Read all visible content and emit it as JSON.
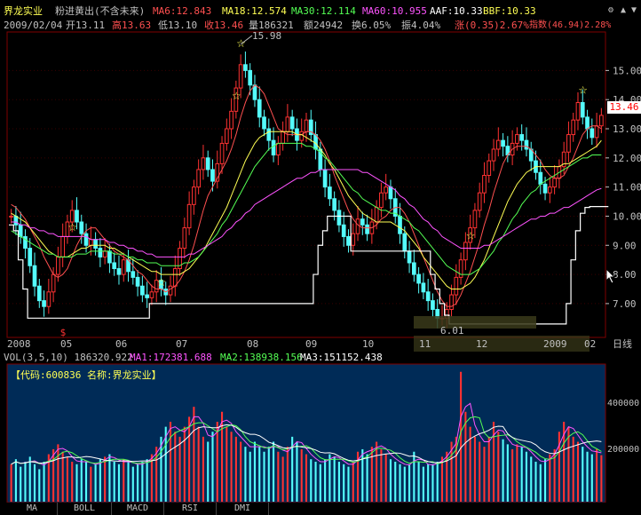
{
  "header": {
    "stock_name": "界龙实业",
    "signal": "粉进黄出(不含未来)",
    "ma6": "MA6:12.843",
    "ma18": "MA18:12.574",
    "ma30": "MA30:12.114",
    "ma60": "MA60:10.955",
    "aaf": "AAF:10.33",
    "bbf": "BBF:10.33"
  },
  "quote": {
    "date": "2009/02/04",
    "open": "开13.11",
    "high": "高13.63",
    "low": "低13.10",
    "close": "收13.46",
    "volume": "量186321",
    "amount": "额24942",
    "turnover": "换6.05%",
    "amplitude": "振4.04%",
    "change": "涨(0.35)2.67%",
    "index": "指数(46.94)2.28%"
  },
  "price_axis": {
    "ticks": [
      "15.00",
      "14.00",
      "13.00",
      "12.00",
      "11.00",
      "10.00",
      "9.00",
      "8.00",
      "7.00"
    ],
    "current_price": "13.46",
    "high_label": "15.98",
    "low_label": "6.01"
  },
  "time_axis": {
    "labels": [
      "2008",
      "05",
      "06",
      "07",
      "08",
      "09",
      "10",
      "11",
      "12",
      "2009",
      "02"
    ],
    "period": "日线"
  },
  "volume": {
    "header": "VOL(3,5,10) 186320.922",
    "ma1": "MA1:172381.688",
    "ma2": "MA2:138938.156",
    "ma3": "MA3:151152.438",
    "code_label": "【代码:600836 名称:界龙实业】",
    "ticks": [
      "400000",
      "200000"
    ]
  },
  "tabs": [
    "MA",
    "BOLL",
    "MACD",
    "RSI",
    "DMI"
  ],
  "colors": {
    "background": "#000000",
    "volume_background": "#002b57",
    "up": "#ff3232",
    "down": "#54fcfc",
    "ma6": "#ff5050",
    "ma18": "#ffff54",
    "ma30": "#54ff54",
    "ma60": "#ff54ff",
    "aaf": "#ffffff"
  },
  "chart_data": {
    "type": "candlestick",
    "price_range": [
      5.9,
      16.2
    ],
    "volume_range": [
      0,
      480000
    ],
    "closes": [
      10.0,
      9.7,
      9.3,
      8.9,
      8.3,
      7.6,
      7.1,
      6.9,
      7.4,
      8.0,
      8.6,
      9.3,
      9.8,
      10.2,
      9.8,
      9.4,
      9.0,
      9.2,
      8.9,
      8.6,
      8.8,
      8.4,
      8.2,
      8.0,
      8.5,
      8.1,
      7.9,
      7.6,
      7.3,
      7.2,
      7.4,
      7.8,
      7.5,
      7.3,
      7.6,
      8.2,
      8.9,
      9.6,
      10.4,
      11.0,
      11.6,
      12.0,
      11.6,
      11.2,
      11.8,
      12.5,
      13.0,
      13.6,
      14.4,
      15.2,
      15.0,
      14.5,
      14.0,
      13.4,
      13.0,
      12.6,
      12.1,
      12.5,
      12.9,
      13.4,
      13.0,
      12.6,
      12.9,
      13.3,
      12.8,
      12.3,
      11.6,
      11.0,
      10.6,
      10.2,
      9.7,
      9.3,
      9.0,
      9.4,
      9.9,
      9.7,
      9.4,
      9.8,
      10.3,
      10.8,
      11.0,
      10.6,
      10.0,
      9.4,
      8.8,
      8.4,
      8.0,
      7.7,
      7.4,
      7.1,
      6.8,
      6.5,
      6.5,
      6.8,
      7.3,
      7.9,
      8.5,
      9.1,
      9.6,
      10.2,
      10.8,
      11.4,
      11.9,
      12.3,
      12.6,
      12.4,
      12.1,
      12.5,
      12.8,
      12.6,
      12.3,
      11.9,
      11.5,
      11.1,
      10.8,
      11.0,
      11.3,
      11.7,
      12.2,
      12.8,
      13.3,
      13.9,
      13.4,
      13.0,
      12.7,
      13.1,
      13.46
    ],
    "volumes": [
      150000,
      170000,
      140000,
      160000,
      180000,
      150000,
      130000,
      160000,
      190000,
      210000,
      230000,
      200000,
      180000,
      160000,
      150000,
      170000,
      160000,
      140000,
      150000,
      170000,
      180000,
      190000,
      160000,
      150000,
      170000,
      160000,
      140000,
      150000,
      160000,
      170000,
      190000,
      220000,
      260000,
      300000,
      320000,
      280000,
      260000,
      300000,
      340000,
      380000,
      300000,
      260000,
      240000,
      280000,
      320000,
      360000,
      300000,
      280000,
      260000,
      240000,
      220000,
      200000,
      240000,
      220000,
      200000,
      220000,
      240000,
      200000,
      180000,
      220000,
      260000,
      240000,
      210000,
      190000,
      170000,
      160000,
      150000,
      170000,
      190000,
      180000,
      160000,
      150000,
      140000,
      160000,
      200000,
      210000,
      190000,
      220000,
      240000,
      210000,
      190000,
      170000,
      160000,
      150000,
      140000,
      150000,
      200000,
      160000,
      140000,
      150000,
      150000,
      160000,
      180000,
      200000,
      240000,
      260000,
      520000,
      360000,
      300000,
      260000,
      240000,
      220000,
      260000,
      320000,
      280000,
      250000,
      230000,
      210000,
      230000,
      220000,
      200000,
      180000,
      160000,
      150000,
      170000,
      190000,
      210000,
      280000,
      320000,
      300000,
      260000,
      240000,
      220000,
      200000,
      190000,
      210000,
      186321
    ],
    "ma6": [
      10.4,
      10.3,
      10.1,
      9.9,
      9.6,
      9.3,
      9.0,
      8.6,
      8.3,
      8.0,
      7.9,
      8.0,
      8.2,
      8.6,
      9.0,
      9.3,
      9.5,
      9.6,
      9.6,
      9.4,
      9.2,
      9.0,
      8.8,
      8.7,
      8.6,
      8.5,
      8.3,
      8.1,
      8.0,
      7.8,
      7.6,
      7.5,
      7.5,
      7.4,
      7.5,
      7.6,
      7.8,
      8.1,
      8.5,
      9.0,
      9.6,
      10.2,
      10.7,
      11.0,
      11.3,
      11.6,
      11.9,
      12.3,
      12.8,
      13.4,
      13.9,
      14.3,
      14.5,
      14.4,
      14.2,
      13.8,
      13.4,
      13.0,
      12.9,
      12.8,
      12.8,
      12.8,
      12.8,
      12.9,
      12.9,
      12.8,
      12.6,
      12.3,
      11.9,
      11.4,
      11.0,
      10.6,
      10.2,
      9.9,
      9.7,
      9.6,
      9.6,
      9.6,
      9.7,
      9.9,
      10.0,
      10.2,
      10.3,
      10.3,
      10.1,
      9.8,
      9.4,
      9.0,
      8.6,
      8.2,
      7.8,
      7.4,
      7.1,
      6.9,
      6.9,
      7.0,
      7.3,
      7.7,
      8.1,
      8.6,
      9.1,
      9.7,
      10.2,
      10.8,
      11.3,
      11.8,
      12.1,
      12.3,
      12.4,
      12.4,
      12.4,
      12.3,
      12.1,
      11.9,
      11.6,
      11.4,
      11.3,
      11.3,
      11.4,
      11.7,
      12.0,
      12.4,
      12.8,
      13.0,
      13.1,
      13.1,
      13.0
    ],
    "ma18": [
      10.1,
      10.0,
      9.9,
      9.8,
      9.6,
      9.4,
      9.2,
      9.0,
      8.8,
      8.7,
      8.6,
      8.6,
      8.6,
      8.7,
      8.8,
      8.9,
      8.9,
      9.0,
      9.0,
      9.0,
      9.0,
      8.9,
      8.9,
      8.8,
      8.7,
      8.6,
      8.5,
      8.4,
      8.3,
      8.2,
      8.1,
      8.1,
      8.0,
      8.0,
      8.0,
      8.0,
      8.0,
      8.1,
      8.2,
      8.4,
      8.6,
      8.8,
      9.1,
      9.4,
      9.7,
      10.0,
      10.3,
      10.7,
      11.1,
      11.5,
      11.9,
      12.2,
      12.5,
      12.7,
      12.8,
      12.9,
      12.9,
      12.9,
      12.9,
      12.9,
      12.9,
      12.8,
      12.8,
      12.7,
      12.6,
      12.5,
      12.3,
      12.1,
      11.8,
      11.6,
      11.3,
      11.0,
      10.7,
      10.5,
      10.3,
      10.1,
      10.0,
      9.9,
      9.8,
      9.8,
      9.8,
      9.8,
      9.7,
      9.6,
      9.5,
      9.3,
      9.1,
      8.9,
      8.6,
      8.4,
      8.2,
      8.0,
      7.8,
      7.6,
      7.5,
      7.5,
      7.5,
      7.6,
      7.7,
      7.9,
      8.2,
      8.5,
      8.9,
      9.3,
      9.7,
      10.1,
      10.5,
      10.8,
      11.1,
      11.3,
      11.5,
      11.6,
      11.7,
      11.7,
      11.7,
      11.7,
      11.7,
      11.7,
      11.8,
      11.8,
      11.9,
      12.0,
      12.1,
      12.2,
      12.3,
      12.4,
      12.6
    ],
    "ma30": [
      9.5,
      9.4,
      9.3,
      9.2,
      9.1,
      9.0,
      8.9,
      8.8,
      8.7,
      8.7,
      8.6,
      8.6,
      8.6,
      8.6,
      8.7,
      8.7,
      8.7,
      8.8,
      8.8,
      8.8,
      8.8,
      8.8,
      8.7,
      8.7,
      8.7,
      8.6,
      8.6,
      8.5,
      8.5,
      8.4,
      8.4,
      8.4,
      8.3,
      8.3,
      8.3,
      8.3,
      8.3,
      8.4,
      8.4,
      8.5,
      8.6,
      8.8,
      9.0,
      9.2,
      9.4,
      9.7,
      9.9,
      10.2,
      10.5,
      10.8,
      11.1,
      11.4,
      11.7,
      11.9,
      12.1,
      12.3,
      12.4,
      12.5,
      12.5,
      12.5,
      12.5,
      12.5,
      12.5,
      12.4,
      12.4,
      12.3,
      12.2,
      12.0,
      11.9,
      11.7,
      11.5,
      11.3,
      11.1,
      10.9,
      10.8,
      10.6,
      10.5,
      10.4,
      10.3,
      10.2,
      10.2,
      10.1,
      10.1,
      10.0,
      9.9,
      9.8,
      9.6,
      9.5,
      9.3,
      9.1,
      8.9,
      8.7,
      8.5,
      8.3,
      8.2,
      8.1,
      8.0,
      8.0,
      8.0,
      8.1,
      8.2,
      8.4,
      8.6,
      8.8,
      9.1,
      9.3,
      9.6,
      9.9,
      10.1,
      10.4,
      10.6,
      10.8,
      10.9,
      11.1,
      11.2,
      11.3,
      11.4,
      11.5,
      11.6,
      11.7,
      11.8,
      11.9,
      12.0,
      12.0,
      12.1,
      12.1,
      12.1
    ],
    "ma60": [
      9.8,
      9.8,
      9.7,
      9.7,
      9.6,
      9.6,
      9.5,
      9.5,
      9.4,
      9.4,
      9.3,
      9.3,
      9.3,
      9.3,
      9.3,
      9.3,
      9.3,
      9.2,
      9.2,
      9.2,
      9.2,
      9.1,
      9.1,
      9.0,
      9.0,
      8.9,
      8.9,
      8.8,
      8.8,
      8.7,
      8.7,
      8.6,
      8.6,
      8.6,
      8.6,
      8.6,
      8.6,
      8.6,
      8.7,
      8.7,
      8.8,
      8.9,
      9.0,
      9.1,
      9.2,
      9.3,
      9.5,
      9.6,
      9.8,
      9.9,
      10.1,
      10.2,
      10.4,
      10.5,
      10.6,
      10.7,
      10.8,
      10.9,
      11.0,
      11.1,
      11.2,
      11.3,
      11.3,
      11.4,
      11.5,
      11.5,
      11.6,
      11.6,
      11.6,
      11.6,
      11.6,
      11.6,
      11.6,
      11.6,
      11.6,
      11.5,
      11.5,
      11.4,
      11.3,
      11.2,
      11.1,
      11.0,
      10.9,
      10.7,
      10.6,
      10.4,
      10.3,
      10.1,
      9.9,
      9.8,
      9.6,
      9.5,
      9.3,
      9.2,
      9.1,
      9.0,
      8.9,
      8.9,
      8.9,
      8.9,
      8.9,
      9.0,
      9.0,
      9.1,
      9.2,
      9.3,
      9.4,
      9.5,
      9.6,
      9.7,
      9.8,
      9.9,
      9.9,
      10.0,
      10.0,
      10.1,
      10.1,
      10.2,
      10.3,
      10.3,
      10.4,
      10.5,
      10.6,
      10.7,
      10.8,
      10.9,
      10.95
    ],
    "aaf": [
      9.7,
      9.5,
      8.5,
      7.5,
      6.5,
      6.5,
      6.5,
      6.5,
      6.5,
      6.5,
      6.5,
      6.5,
      6.5,
      6.5,
      6.5,
      6.5,
      6.5,
      6.5,
      6.5,
      6.5,
      6.5,
      6.5,
      6.5,
      6.5,
      6.5,
      6.5,
      6.5,
      6.5,
      6.5,
      6.5,
      7.0,
      7.0,
      7.0,
      7.0,
      7.0,
      7.0,
      7.0,
      7.0,
      7.0,
      7.0,
      7.0,
      7.0,
      7.0,
      7.0,
      7.0,
      7.0,
      7.0,
      7.0,
      7.0,
      7.0,
      7.0,
      7.0,
      7.0,
      7.0,
      7.0,
      7.0,
      7.0,
      7.0,
      7.0,
      7.0,
      7.0,
      7.0,
      7.0,
      7.0,
      7.0,
      8.0,
      9.0,
      9.5,
      10.0,
      10.0,
      10.0,
      10.0,
      10.0,
      8.8,
      8.8,
      8.8,
      8.8,
      8.8,
      8.8,
      8.8,
      8.8,
      8.8,
      8.8,
      8.8,
      8.8,
      8.8,
      8.8,
      8.8,
      8.8,
      8.8,
      8.0,
      7.5,
      7.0,
      6.6,
      6.3,
      6.3,
      6.3,
      6.3,
      6.3,
      6.3,
      6.3,
      6.3,
      6.3,
      6.3,
      6.3,
      6.3,
      6.3,
      6.3,
      6.3,
      6.3,
      6.3,
      6.3,
      6.3,
      6.3,
      6.3,
      6.3,
      6.3,
      6.3,
      6.3,
      7.0,
      8.5,
      9.5,
      10.1,
      10.3,
      10.33,
      10.33,
      10.33,
      10.33
    ]
  }
}
